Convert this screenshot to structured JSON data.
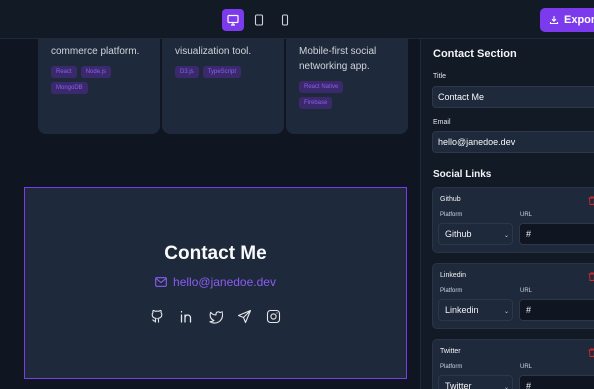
{
  "toolbar": {
    "export_label": "Export",
    "devices": [
      "desktop-icon",
      "tablet-icon",
      "phone-icon"
    ],
    "active_device": "desktop",
    "accent": "#7c3aed"
  },
  "preview": {
    "projects": [
      {
        "desc_lines": [
          "commerce platform."
        ],
        "tags": [
          "React",
          "Node.js",
          "MongoDB"
        ]
      },
      {
        "desc_lines": [
          "visualization tool."
        ],
        "tags": [
          "D3.js",
          "TypeScript"
        ]
      },
      {
        "desc_lines": [
          "Mobile-first social",
          "networking app."
        ],
        "tags": [
          "React Native",
          "Firebase"
        ]
      }
    ],
    "contact": {
      "title": "Contact Me",
      "email": "hello@janedoe.dev",
      "socials": [
        "github-icon",
        "linkedin-icon",
        "twitter-icon",
        "telegram-icon",
        "instagram-icon"
      ]
    }
  },
  "panel": {
    "section_title": "Contact Section",
    "title_label": "Title",
    "title_value": "Contact Me",
    "email_label": "Email",
    "email_value": "hello@janedoe.dev",
    "social_links_title": "Social Links",
    "platform_label": "Platform",
    "url_label": "URL",
    "links": [
      {
        "name": "Github",
        "platform": "Github",
        "url": "#"
      },
      {
        "name": "Linkedin",
        "platform": "Linkedin",
        "url": "#"
      },
      {
        "name": "Twitter",
        "platform": "Twitter",
        "url": "#"
      }
    ]
  }
}
